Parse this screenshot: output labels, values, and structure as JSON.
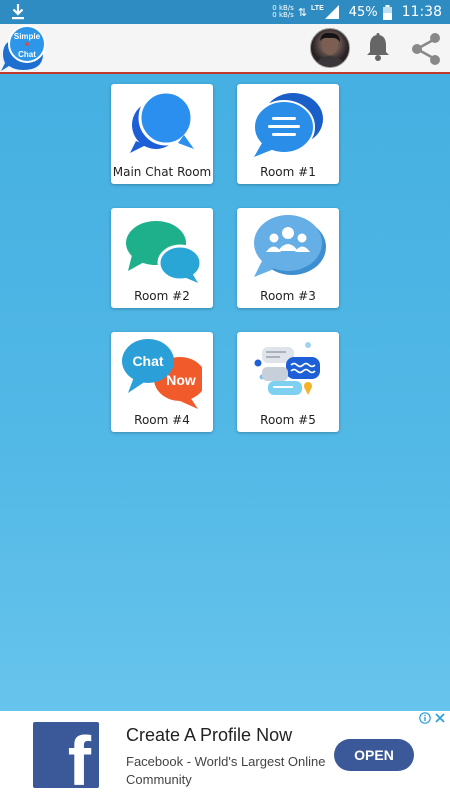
{
  "status_bar": {
    "net_speed_up": "0 kB/s",
    "net_speed_down": "0 kB/s",
    "network_type": "LTE",
    "battery_percent": "45%",
    "time": "11:38"
  },
  "app_bar": {
    "logo_line1": "Simple",
    "logo_line2": "Chat",
    "accent_color": "#c0392b"
  },
  "rooms": [
    {
      "label": "Main Chat Room",
      "icon": "double-speech-bubble-icon"
    },
    {
      "label": "Room #1",
      "icon": "message-lines-bubble-icon"
    },
    {
      "label": "Room #2",
      "icon": "green-teal-bubbles-icon"
    },
    {
      "label": "Room #3",
      "icon": "group-bubble-icon"
    },
    {
      "label": "Room #4",
      "icon": "chat-now-bubbles-icon",
      "bubble_text_1": "Chat",
      "bubble_text_2": "Now"
    },
    {
      "label": "Room #5",
      "icon": "colorful-messages-icon"
    }
  ],
  "ad": {
    "title": "Create A Profile Now",
    "body": "Facebook - World's Largest Online Community",
    "button_label": "OPEN",
    "brand_color": "#3b5998",
    "logo_letter": "f"
  }
}
